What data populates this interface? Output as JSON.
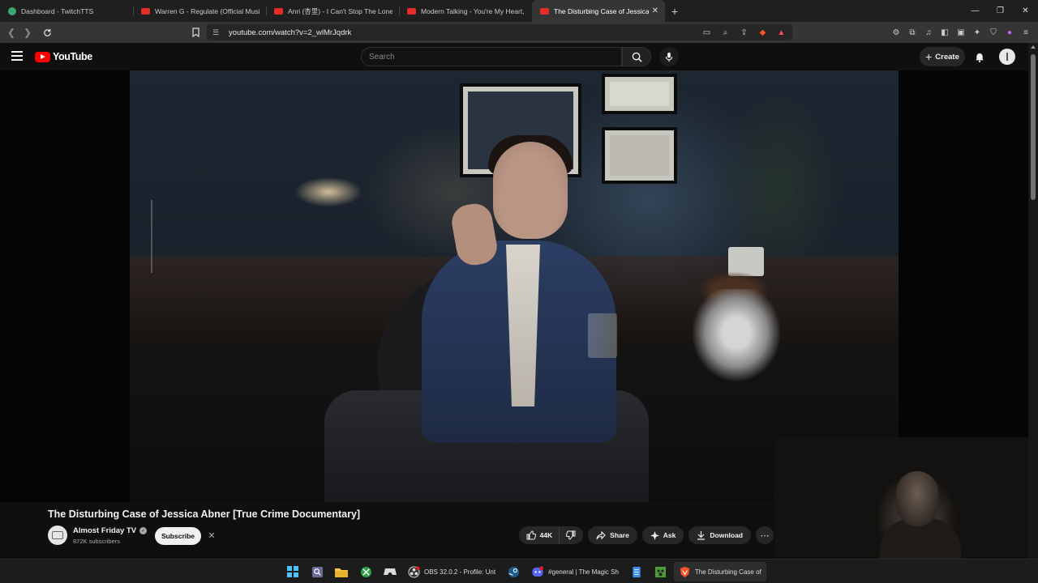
{
  "browser": {
    "tabs": [
      {
        "title": "Dashboard - TwitchTTS",
        "favicon": "twitchtts",
        "active": false
      },
      {
        "title": "Warren G - Regulate (Official Music V",
        "favicon": "youtube",
        "active": false
      },
      {
        "title": "Anri (杏里) - I Can't Stop The Lonelin",
        "favicon": "youtube",
        "active": false
      },
      {
        "title": "Modern Talking - You're My Heart, Yo",
        "favicon": "youtube",
        "active": false
      },
      {
        "title": "The Disturbing Case of Jessica Al",
        "favicon": "youtube",
        "active": true
      }
    ],
    "url": "youtube.com/watch?v=2_wlMrJqdrk"
  },
  "youtube": {
    "logo_text": "YouTube",
    "search_placeholder": "Search",
    "create_label": "Create"
  },
  "video": {
    "title": "The Disturbing Case of Jessica Abner [True Crime Documentary]",
    "channel_name": "Almost Friday TV",
    "subscribers": "872K subscribers",
    "subscribe_label": "Subscribe",
    "like_count": "44K",
    "share_label": "Share",
    "ask_label": "Ask",
    "download_label": "Download"
  },
  "taskbar": {
    "apps": [
      {
        "label": "OBS 32.0.2 - Profile: Unt",
        "icon": "obs-icon"
      },
      {
        "label": "#general | The Magic Sh",
        "icon": "discord-icon"
      },
      {
        "label": "The Disturbing Case of",
        "icon": "browser-icon"
      }
    ]
  },
  "colors": {
    "youtube_red": "#ff0000",
    "background": "#0f0f0f",
    "pill": "#272727",
    "windows_blue": "#4cc2ff"
  }
}
